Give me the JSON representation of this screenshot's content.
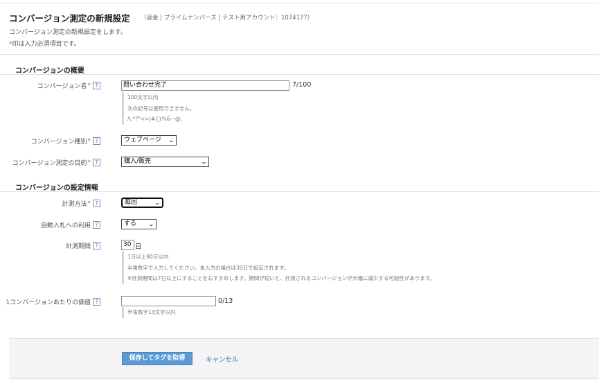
{
  "header": {
    "title": "コンバージョン測定の新規設定",
    "meta": "（返金 | プライムナンバーズ | テスト用アカウント：1074177）",
    "description": "コンバージョン測定の新規設定をします。",
    "required_star": "*",
    "required_note": "印は入力必須項目です。"
  },
  "sections": {
    "overview_title": "コンバージョンの概要",
    "settings_title": "コンバージョンの設定情報"
  },
  "help_glyph": "?",
  "form": {
    "conversion_name": {
      "label": "コンバージョン名",
      "value": "問い合わせ完了",
      "counter": "7/100",
      "hints": [
        "100文字以内",
        "次の記号は使用できません。",
        "/\\:*?\"<>|#{}%&~@;"
      ]
    },
    "conversion_type": {
      "label": "コンバージョン種別",
      "value": "ウェブページ"
    },
    "conversion_purpose": {
      "label": "コンバージョン測定の目的",
      "value": "購入/販売"
    },
    "counting_method": {
      "label": "計測方法",
      "value": "毎回"
    },
    "auto_bidding": {
      "label": "自動入札への利用",
      "value": "する"
    },
    "measurement_period": {
      "label": "計測期間",
      "value": "30",
      "unit": "日",
      "hints": [
        "1日以上90日以内",
        "半角数字で入力してください。未入力の場合は30日で設定されます。",
        "※計測期間は7日以上にすることをおすすめします。期間が短いと、計測されるコンバージョンが大幅に減少する可能性があります。"
      ]
    },
    "value_per_conversion": {
      "label": "1コンバージョンあたりの価値",
      "value": "",
      "counter": "0/13",
      "hints": [
        "半角数字13文字以内"
      ]
    }
  },
  "footer": {
    "save_label": "保存してタグを取得",
    "cancel_label": "キャンセル"
  },
  "colors": {
    "required": "#d9534f",
    "primary_button": "#5b9bd5",
    "link": "#3b6fb6"
  }
}
